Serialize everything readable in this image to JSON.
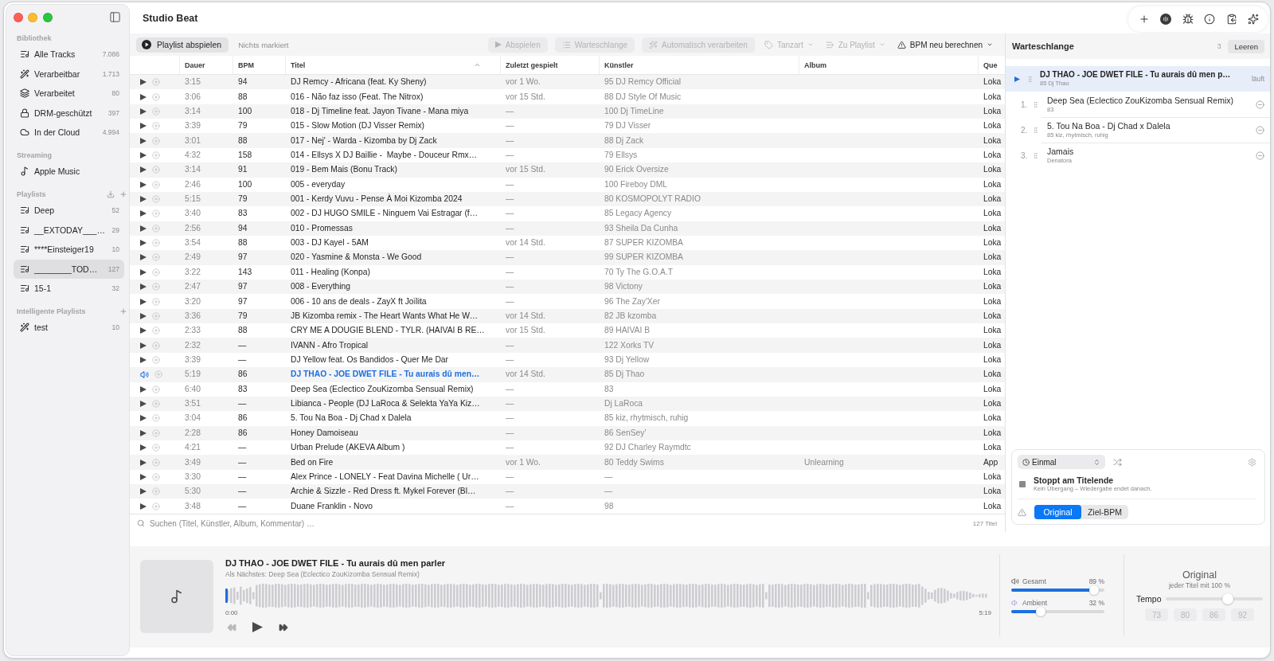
{
  "window": {
    "title": "Studio Beat",
    "tools": [
      {
        "kind": "add"
      },
      {
        "kind": "disc"
      },
      {
        "kind": "bug"
      },
      {
        "kind": "info"
      },
      {
        "kind": "clipboard"
      },
      {
        "kind": "sparkle"
      }
    ]
  },
  "sidebar": {
    "sections": [
      {
        "heading": "Bibliothek",
        "items": [
          {
            "label": "Alle Tracks",
            "count": "7.086",
            "kind": "playlist",
            "selected": false
          },
          {
            "label": "Verarbeitbar",
            "count": "1.713",
            "kind": "wand",
            "selected": false
          },
          {
            "label": "Verarbeitet",
            "count": "80",
            "kind": "layers",
            "selected": false
          },
          {
            "label": "DRM-geschützt",
            "count": "397",
            "kind": "lock",
            "selected": false
          },
          {
            "label": "In der Cloud",
            "count": "4.994",
            "kind": "cloud",
            "selected": false
          }
        ]
      },
      {
        "heading": "Streaming",
        "items": [
          {
            "label": "Apple Music",
            "kind": "note",
            "selected": false
          }
        ]
      },
      {
        "heading": "Playlists",
        "actions": [
          {
            "kind": "import"
          },
          {
            "kind": "add"
          }
        ],
        "items": [
          {
            "label": "Deep",
            "count": "52",
            "kind": "playlist",
            "selected": false
          },
          {
            "label": "__EXTODAY___…",
            "count": "29",
            "kind": "playlist",
            "selected": false
          },
          {
            "label": "****Einsteiger19",
            "count": "10",
            "kind": "playlist",
            "selected": false
          },
          {
            "label": "________TOD…",
            "count": "127",
            "kind": "playlist",
            "selected": true
          },
          {
            "label": "15-1",
            "count": "32",
            "kind": "playlist",
            "selected": false
          }
        ]
      },
      {
        "heading": "Intelligente Playlists",
        "actions": [
          {
            "kind": "add"
          }
        ],
        "items": [
          {
            "label": "test",
            "count": "10",
            "kind": "wand",
            "selected": false
          }
        ]
      }
    ]
  },
  "toolbar": {
    "primary": "Playlist abspielen",
    "selection": "Nichts markiert",
    "actions": [
      {
        "label": "Abspielen",
        "kind": "play",
        "disabled": true,
        "menu": false
      },
      {
        "label": "Warteschlange",
        "kind": "queue",
        "disabled": true,
        "menu": false
      },
      {
        "label": "Automatisch verarbeiten",
        "kind": "wand",
        "disabled": true,
        "menu": false
      },
      {
        "label": "Tanzart",
        "kind": "tag",
        "disabled": true,
        "menu": true
      },
      {
        "label": "Zu Playlist",
        "kind": "playlist",
        "disabled": true,
        "menu": true
      },
      {
        "label": "BPM neu berechnen",
        "kind": "warning",
        "disabled": false,
        "menu": true
      }
    ]
  },
  "table": {
    "columns": [
      {
        "label": "Dauer",
        "sorted": false
      },
      {
        "label": "BPM",
        "sorted": false
      },
      {
        "label": "Titel",
        "sorted": true
      },
      {
        "label": "Zuletzt gespielt",
        "sorted": false
      },
      {
        "label": "Künstler",
        "sorted": false
      },
      {
        "label": "Album",
        "sorted": false
      },
      {
        "label": "Que",
        "sorted": false
      }
    ],
    "rows": [
      {
        "playing": false,
        "duration": "3:15",
        "bpm": "94",
        "title": "DJ Remcy - Africana (feat. Ky Sheny)",
        "last_played": "vor 1 Wo.",
        "artist": "95 DJ Remcy Official",
        "source": "Loka"
      },
      {
        "playing": false,
        "duration": "3:06",
        "bpm": "88",
        "title": "016 - Não faz isso (Feat. The Nitrox)",
        "last_played": "vor 15 Std.",
        "artist": "88 DJ Style Of Music",
        "source": "Loka"
      },
      {
        "playing": false,
        "duration": "3:14",
        "bpm": "100",
        "title": "018 - Dj Timeline feat. Jayon Tivane - Mana miya",
        "last_played": "—",
        "artist": "100 Dj TimeLine",
        "source": "Loka"
      },
      {
        "playing": false,
        "duration": "3:39",
        "bpm": "79",
        "title": "015 - Slow Motion (DJ Visser Remix)",
        "last_played": "—",
        "artist": "79 DJ Visser",
        "source": "Loka"
      },
      {
        "playing": false,
        "duration": "3:01",
        "bpm": "88",
        "title": "017 - Nej' - Warda - Kizomba by Dj Zack",
        "last_played": "—",
        "artist": "88 Dj Zack",
        "source": "Loka"
      },
      {
        "playing": false,
        "duration": "4:32",
        "bpm": "158",
        "title": "014 - Ellsys X DJ Baillie -  Maybe - Douceur Rmx…",
        "last_played": "—",
        "artist": "79 Ellsys",
        "source": "Loka"
      },
      {
        "playing": false,
        "duration": "3:14",
        "bpm": "91",
        "title": "019 - Bem Mais (Bonu Track)",
        "last_played": "vor 15 Std.",
        "artist": "90 Erick Oversize",
        "source": "Loka"
      },
      {
        "playing": false,
        "duration": "2:46",
        "bpm": "100",
        "title": "005 - everyday",
        "last_played": "—",
        "artist": "100 Fireboy DML",
        "source": "Loka"
      },
      {
        "playing": false,
        "duration": "5:15",
        "bpm": "79",
        "title": "001 - Kerdy Vuvu - Pense À Moi Kizomba 2024",
        "last_played": "—",
        "artist": "80 KOSMOPOLYT RADIO",
        "source": "Loka"
      },
      {
        "playing": false,
        "duration": "3:40",
        "bpm": "83",
        "title": "002 - DJ HUGO SMILE - Ninguem Vai Estragar (f…",
        "last_played": "—",
        "artist": "85 Legacy Agency",
        "source": "Loka"
      },
      {
        "playing": false,
        "duration": "2:56",
        "bpm": "94",
        "title": "010 - Promessas",
        "last_played": "—",
        "artist": "93 Sheila Da Cunha",
        "source": "Loka"
      },
      {
        "playing": false,
        "duration": "3:54",
        "bpm": "88",
        "title": "003 - DJ Kayel - 5AM",
        "last_played": "vor 14 Std.",
        "artist": "87 SUPER KIZOMBA",
        "source": "Loka"
      },
      {
        "playing": false,
        "duration": "2:49",
        "bpm": "97",
        "title": "020 - Yasmine & Monsta - We Good",
        "last_played": "—",
        "artist": "99 SUPER KIZOMBA",
        "source": "Loka"
      },
      {
        "playing": false,
        "duration": "3:22",
        "bpm": "143",
        "title": "011 - Healing (Konpa)",
        "last_played": "—",
        "artist": "70 Ty The G.O.A.T",
        "source": "Loka"
      },
      {
        "playing": false,
        "duration": "2:47",
        "bpm": "97",
        "title": "008 - Everything",
        "last_played": "—",
        "artist": "98 Victony",
        "source": "Loka"
      },
      {
        "playing": false,
        "duration": "3:20",
        "bpm": "97",
        "title": "006 - 10 ans de deals - ZayX ft Joïlita",
        "last_played": "—",
        "artist": "96 The Zay'Xer",
        "source": "Loka"
      },
      {
        "playing": false,
        "duration": "3:36",
        "bpm": "79",
        "title": "JB Kizomba remix - The Heart Wants What He W…",
        "last_played": "vor 14 Std.",
        "artist": "82 JB kzomba",
        "source": "Loka"
      },
      {
        "playing": false,
        "duration": "2:33",
        "bpm": "88",
        "title": "CRY ME A DOUGIE BLEND - TYLR. (HAIVAI B RE…",
        "last_played": "vor 15 Std.",
        "artist": "89 HAIVAI B",
        "source": "Loka"
      },
      {
        "playing": false,
        "duration": "2:32",
        "bpm": "—",
        "title": "IVANN - Afro Tropical",
        "last_played": "—",
        "artist": "122 Xorks TV",
        "source": "Loka"
      },
      {
        "playing": false,
        "duration": "3:39",
        "bpm": "—",
        "title": "DJ Yellow feat. Os Bandidos - Quer Me Dar",
        "last_played": "—",
        "artist": "93 Dj Yellow",
        "source": "Loka"
      },
      {
        "playing": true,
        "duration": "5:19",
        "bpm": "86",
        "title": "DJ THAO - JOE DWET FILE - Tu aurais dû men…",
        "last_played": "vor 14 Std.",
        "artist": "85 Dj Thao",
        "source": "Loka"
      },
      {
        "playing": false,
        "duration": "6:40",
        "bpm": "83",
        "title": "Deep Sea (Eclectico ZouKizomba Sensual Remix)",
        "last_played": "—",
        "artist": "83",
        "source": "Loka"
      },
      {
        "playing": false,
        "duration": "3:51",
        "bpm": "—",
        "title": "Libianca - People (DJ LaRoca & Selekta YaYa Kiz…",
        "last_played": "—",
        "artist": "Dj LaRoca",
        "source": "Loka"
      },
      {
        "playing": false,
        "duration": "3:04",
        "bpm": "86",
        "title": "5. Tou Na Boa - Dj Chad x Dalela",
        "last_played": "—",
        "artist": "85 kiz, rhytmisch, ruhig",
        "source": "Loka"
      },
      {
        "playing": false,
        "duration": "2:28",
        "bpm": "86",
        "title": "Honey Damoiseau",
        "last_played": "—",
        "artist": "86 SenSey'",
        "source": "Loka"
      },
      {
        "playing": false,
        "duration": "4:21",
        "bpm": "—",
        "title": "Urban Prelude (AKEVA Album )",
        "last_played": "—",
        "artist": "92 DJ Charley Raymdtc",
        "source": "Loka"
      },
      {
        "playing": false,
        "duration": "3:49",
        "bpm": "—",
        "title": "Bed on Fire",
        "last_played": "vor 1 Wo.",
        "artist": "80 Teddy Swims",
        "album": "Unlearning",
        "source": "App"
      },
      {
        "playing": false,
        "duration": "3:30",
        "bpm": "—",
        "title": "Alex Prince - LONELY - Feat Davina Michelle ( Ur…",
        "last_played": "—",
        "artist": "—",
        "source": "Loka"
      },
      {
        "playing": false,
        "duration": "5:30",
        "bpm": "—",
        "title": "Archie & Sizzle - Red Dress ft. Mykel Forever (Bl…",
        "last_played": "—",
        "artist": "—",
        "source": "Loka"
      },
      {
        "playing": false,
        "duration": "3:48",
        "bpm": "—",
        "title": "Duane Franklin - Novo",
        "last_played": "—",
        "artist": "98",
        "source": "Loka"
      }
    ]
  },
  "search": {
    "placeholder": "Suchen (Titel, Künstler, Album, Kommentar) …",
    "count": "127 Titel"
  },
  "queue": {
    "title": "Warteschlange",
    "count": "3",
    "clear": "Leeren",
    "now_playing": {
      "title": "DJ THAO - JOE DWET FILE - Tu aurais dû men p…",
      "subtitle": "85 Dj Thao",
      "status": "läuft"
    },
    "items": [
      {
        "number": "1.",
        "title": "Deep Sea (Eclectico ZouKizomba Sensual Remix)",
        "subtitle": "83"
      },
      {
        "number": "2.",
        "title": "5. Tou Na Boa - Dj Chad x Dalela",
        "subtitle": "85 kiz, rhytmisch, ruhig"
      },
      {
        "number": "3.",
        "title": "Jamais",
        "subtitle": "Denatora"
      }
    ],
    "repeat": "Einmal",
    "stop": {
      "title": "Stoppt am Titelende",
      "subtitle": "Kein Übergang – Wiedergabe endet danach."
    },
    "modes": [
      {
        "label": "Original",
        "selected": true
      },
      {
        "label": "Ziel-BPM",
        "selected": false
      }
    ]
  },
  "player": {
    "title": "DJ THAO - JOE DWET FILE - Tu aurais dû men parler",
    "next": "Als Nächstes: Deep Sea (Eclectico ZouKizomba Sensual Remix)",
    "level": 0,
    "elapsed": "0:00",
    "total": "5:19",
    "transport": [
      {
        "kind": "previous",
        "disabled": true
      },
      {
        "kind": "play",
        "disabled": false
      },
      {
        "kind": "next",
        "disabled": false
      }
    ],
    "mixer": [
      {
        "kind": "speaker",
        "label": "Gesamt",
        "reading": "89 %",
        "level": 0.89
      },
      {
        "kind": "ambient",
        "label": "Ambient",
        "reading": "32 %",
        "level": 0.32
      }
    ],
    "tempo": {
      "mode": "Original",
      "hint": "jeder Titel mit 100 %",
      "label": "Tempo",
      "level": 0.64,
      "presets": [
        {
          "label": "73",
          "disabled": true
        },
        {
          "label": "80",
          "disabled": true
        },
        {
          "label": "86",
          "disabled": true
        },
        {
          "label": "92",
          "disabled": true
        }
      ]
    }
  }
}
